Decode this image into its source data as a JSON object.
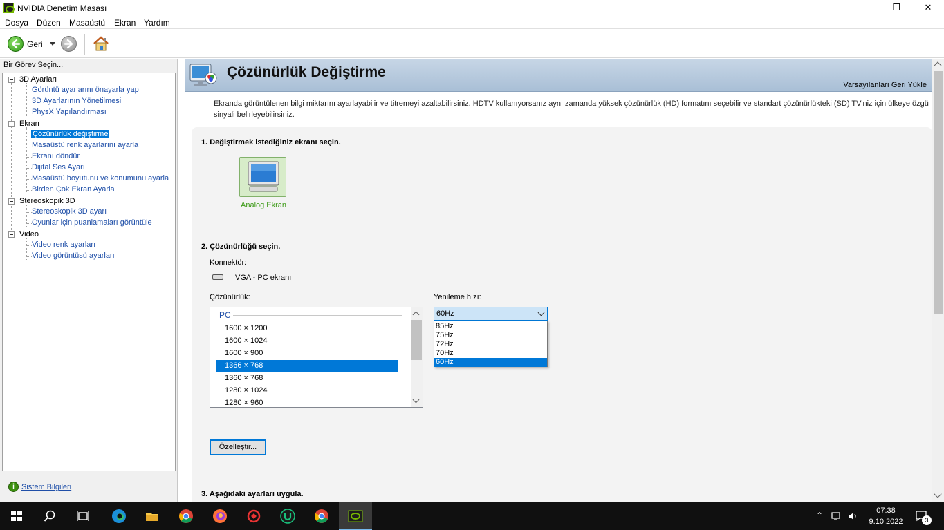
{
  "window": {
    "title": "NVIDIA Denetim Masası",
    "controls": {
      "minimize": "—",
      "maximize": "❐",
      "close": "✕"
    }
  },
  "menu": [
    "Dosya",
    "Düzen",
    "Masaüstü",
    "Ekran",
    "Yardım"
  ],
  "toolbar": {
    "back_label": "Geri"
  },
  "left_panel": {
    "heading": "Bir Görev Seçin...",
    "tree": [
      {
        "label": "3D Ayarları",
        "children": [
          "Görüntü ayarlarını önayarla yap",
          "3D Ayarlarının Yönetilmesi",
          "PhysX Yapılandırması"
        ]
      },
      {
        "label": "Ekran",
        "children": [
          "Çözünürlük değiştirme",
          "Masaüstü renk ayarlarını ayarla",
          "Ekranı döndür",
          "Dijital Ses Ayarı",
          "Masaüstü boyutunu ve konumunu ayarla",
          "Birden Çok Ekran Ayarla"
        ]
      },
      {
        "label": "Stereoskopik 3D",
        "children": [
          "Stereoskopik 3D ayarı",
          "Oyunlar için puanlamaları görüntüle"
        ]
      },
      {
        "label": "Video",
        "children": [
          "Video renk ayarları",
          "Video görüntüsü ayarları"
        ]
      }
    ],
    "selected": "Çözünürlük değiştirme",
    "system_info": "Sistem Bilgileri"
  },
  "page": {
    "title": "Çözünürlük Değiştirme",
    "restore_defaults": "Varsayılanları Geri Yükle",
    "description": "Ekranda görüntülenen bilgi miktarını ayarlayabilir ve titremeyi azaltabilirsiniz. HDTV kullanıyorsanız aynı zamanda yüksek çözünürlük (HD) formatını seçebilir ve standart çözünürlükteki (SD) TV'niz için ülkeye özgü sinyali belirleyebilirsiniz.",
    "step1": "1. Değiştirmek istediğiniz ekranı seçin.",
    "display_name": "Analog Ekran",
    "step2": "2. Çözünürlüğü seçin.",
    "connector_label": "Konnektör:",
    "connector_value": "VGA - PC ekranı",
    "resolution_label": "Çözünürlük:",
    "resolution_group": "PC",
    "resolutions": [
      "1600 × 1200",
      "1600 × 1024",
      "1600 × 900",
      "1366 × 768",
      "1360 × 768",
      "1280 × 1024",
      "1280 × 960"
    ],
    "selected_resolution": "1366 × 768",
    "refresh_label": "Yenileme hızı:",
    "refresh_value": "60Hz",
    "refresh_options": [
      "85Hz",
      "75Hz",
      "72Hz",
      "70Hz",
      "60Hz"
    ],
    "customize_button": "Özelleştir...",
    "step3": "3. Aşağıdaki ayarları uygula."
  },
  "taskbar": {
    "time": "07:38",
    "date": "9.10.2022",
    "notifications": "3"
  },
  "colors": {
    "accent": "#0078d7",
    "nvidia_green": "#76b900",
    "header_band": "#b8cbe0",
    "link": "#1f4fa8"
  }
}
